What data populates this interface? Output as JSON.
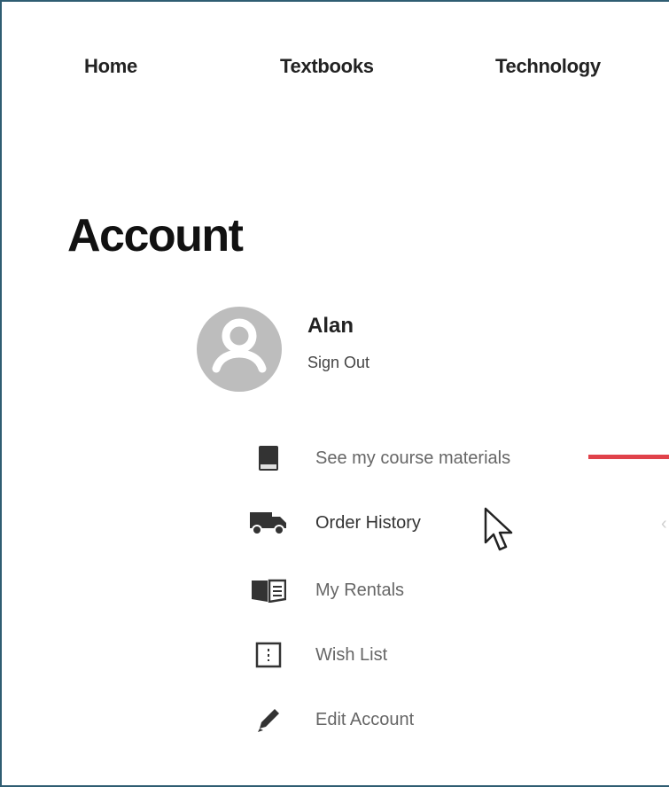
{
  "nav": {
    "items": [
      {
        "label": "Home"
      },
      {
        "label": "Textbooks"
      },
      {
        "label": "Technology"
      }
    ]
  },
  "page": {
    "title": "Account"
  },
  "user": {
    "name": "Alan",
    "sign_out_label": "Sign Out",
    "avatar_icon": "user-avatar-icon"
  },
  "menu": {
    "items": [
      {
        "label": "See my course materials",
        "icon": "book-icon"
      },
      {
        "label": "Order History",
        "icon": "truck-icon"
      },
      {
        "label": "My Rentals",
        "icon": "open-book-icon"
      },
      {
        "label": "Wish List",
        "icon": "list-icon"
      },
      {
        "label": "Edit Account",
        "icon": "pencil-icon"
      }
    ]
  },
  "colors": {
    "accent": "#e0424a",
    "frame_border": "#2f5d72",
    "avatar": "#bdbdbd",
    "icon": "#333333"
  }
}
